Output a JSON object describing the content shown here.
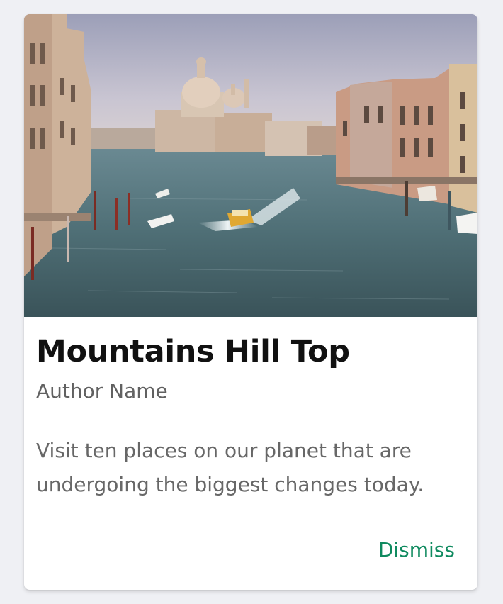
{
  "card": {
    "title": "Mountains Hill Top",
    "author": "Author Name",
    "description": "Visit ten places on our planet that are undergoing the biggest changes today.",
    "dismiss_label": "Dismiss",
    "image_alt": "Venice Grand Canal"
  },
  "colors": {
    "page_background": "#eff0f4",
    "card_background": "#ffffff",
    "title": "#111111",
    "text_muted": "#676767",
    "accent": "#0f8a5f"
  }
}
